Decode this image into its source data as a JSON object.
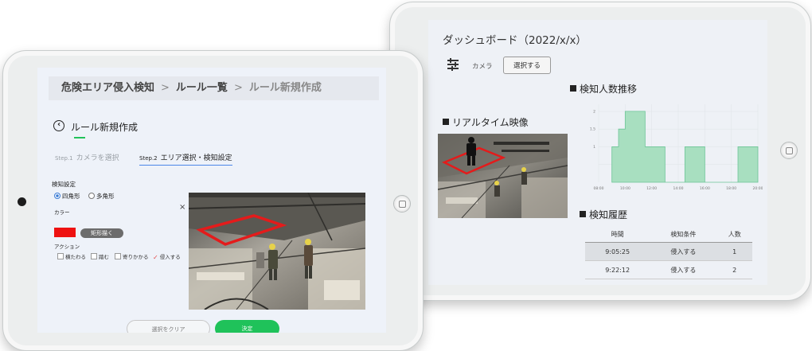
{
  "dashboard": {
    "title": "ダッシュボード（2022/x/x）",
    "camera_label": "カメラ",
    "select_button": "選択する",
    "live_video_title": "リアルタイム映像",
    "trend_title": "検知人数推移",
    "history_title": "検知履歴",
    "history": {
      "columns": [
        "時間",
        "検知条件",
        "人数"
      ],
      "rows": [
        [
          "9:05:25",
          "侵入する",
          "1"
        ],
        [
          "9:22:12",
          "侵入する",
          "2"
        ]
      ]
    }
  },
  "chart_data": {
    "type": "area",
    "x": [
      "08:00",
      "10:00",
      "12:00",
      "14:00",
      "16:00",
      "18:00",
      "20:00"
    ],
    "series": [
      {
        "values": [
          {
            "x": "09:00",
            "y": 1
          },
          {
            "x": "09:30",
            "y": 1.5
          },
          {
            "x": "10:00",
            "y": 2
          },
          {
            "x": "11:30",
            "y": 1
          },
          {
            "x": "13:00",
            "y": 0
          },
          {
            "x": "14:30",
            "y": 1
          },
          {
            "x": "16:00",
            "y": 0
          },
          {
            "x": "18:30",
            "y": 1
          },
          {
            "x": "20:00",
            "y": 0
          }
        ]
      }
    ],
    "yticks": [
      "2",
      "1.5",
      "1"
    ],
    "color": "#a8dfc0",
    "edge_color": "#6cc596",
    "grid": true
  },
  "rule_editor": {
    "breadcrumb": [
      "危険エリア侵入検知",
      "ルール一覧",
      "ルール新規作成"
    ],
    "breadcrumb_separator": ">",
    "page_title": "ルール新規作成",
    "steps": [
      {
        "no": "Step.1",
        "label": "カメラを選択"
      },
      {
        "no": "Step.2",
        "label": "エリア選択・検知設定"
      }
    ],
    "detection_settings_label": "検知設定",
    "shape_options": [
      "四角形",
      "多角形"
    ],
    "selected_shape": "四角形",
    "color_label": "カラー",
    "color_value": "#ee1111",
    "shape_draw_button": "矩形描く",
    "action_label": "アクション",
    "actions": [
      {
        "label": "横たわる",
        "checked": false
      },
      {
        "label": "踏む",
        "checked": false
      },
      {
        "label": "寄りかかる",
        "checked": false
      },
      {
        "label": "侵入する",
        "checked": true
      }
    ],
    "close_icon_glyph": "×",
    "clear_button": "選択をクリア",
    "confirm_button": "決定"
  }
}
